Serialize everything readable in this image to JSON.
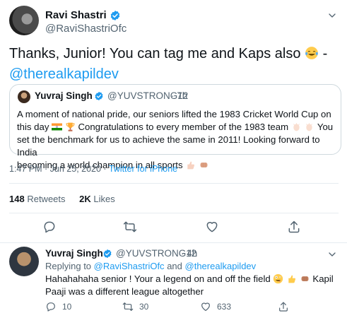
{
  "main_tweet": {
    "name": "Ravi Shastri",
    "handle": "@RaviShastriOfc",
    "text_lead": "Thanks, Junior! You can tag me and Kaps also",
    "text_tail": " -",
    "mention": "@therealkapildev",
    "emoji": "tears-of-joy",
    "quote": {
      "name": "Yuvraj Singh",
      "handle": "@YUVSTRONG12",
      "time": "· 7h",
      "line1": "A moment of national pride, our seniors lifted the 1983 Cricket World Cup on",
      "line2a": "this day",
      "line2b": "Congratulations to every member of the 1983 team",
      "line2c": "You",
      "line3": "set the benchmark for us to achieve the same in 2011! Looking forward to India",
      "line4": "becoming a world champion in all sports"
    },
    "timestamp": "1:47 PM · Jun 25, 2020 · ",
    "source": "Twitter for iPhone",
    "retweets_count": "148",
    "retweets_label": "Retweets",
    "likes_count": "2K",
    "likes_label": "Likes"
  },
  "reply_tweet": {
    "name": "Yuvraj Singh",
    "handle": "@YUVSTRONG12",
    "time": "· 4h",
    "replying_prefix": "Replying to",
    "replying_mention1": "@RaviShastriOfc",
    "replying_and": "and",
    "replying_mention2": "@therealkapildev",
    "text_line1a": "Hahahahaha senior ! Your a legend on and off the field",
    "text_line1b": "Kapil",
    "text_line2": "Paaji was a different league altogether",
    "reply_count": "10",
    "retweet_count": "30",
    "like_count": "633"
  },
  "colors": {
    "accent": "#1d9bf0",
    "text": "#0f1419",
    "muted": "#536471",
    "border": "#cfd9de"
  }
}
